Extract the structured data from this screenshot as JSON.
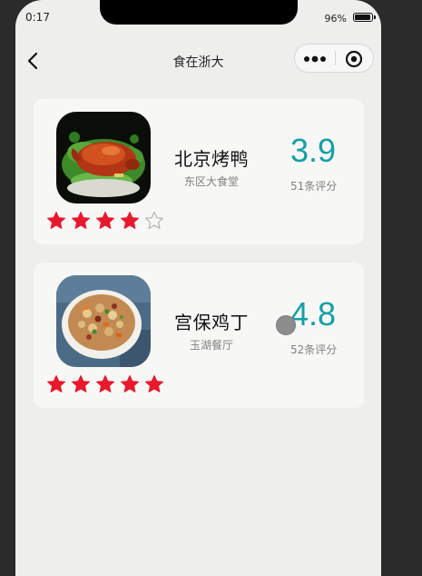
{
  "status_bar": {
    "time": "0:17",
    "battery_percent": "96%",
    "battery_level": 0.96
  },
  "nav": {
    "title": "食在浙大",
    "back_icon": "chevron-left-icon",
    "more_icon": "more-dots-icon",
    "close_icon": "target-circle-icon"
  },
  "dishes": [
    {
      "name": "北京烤鸭",
      "place": "东区大食堂",
      "score": "3.9",
      "reviews": "51条评分",
      "stars": 4,
      "max_stars": 5
    },
    {
      "name": "宫保鸡丁",
      "place": "玉湖餐厅",
      "score": "4.8",
      "reviews": "52条评分",
      "stars": 5,
      "max_stars": 5
    }
  ],
  "colors": {
    "accent": "#14a0a8",
    "star_filled": "#e8192c",
    "star_empty": "#b8b8b8",
    "background": "#eeeeed",
    "card": "#f7f7f6"
  }
}
